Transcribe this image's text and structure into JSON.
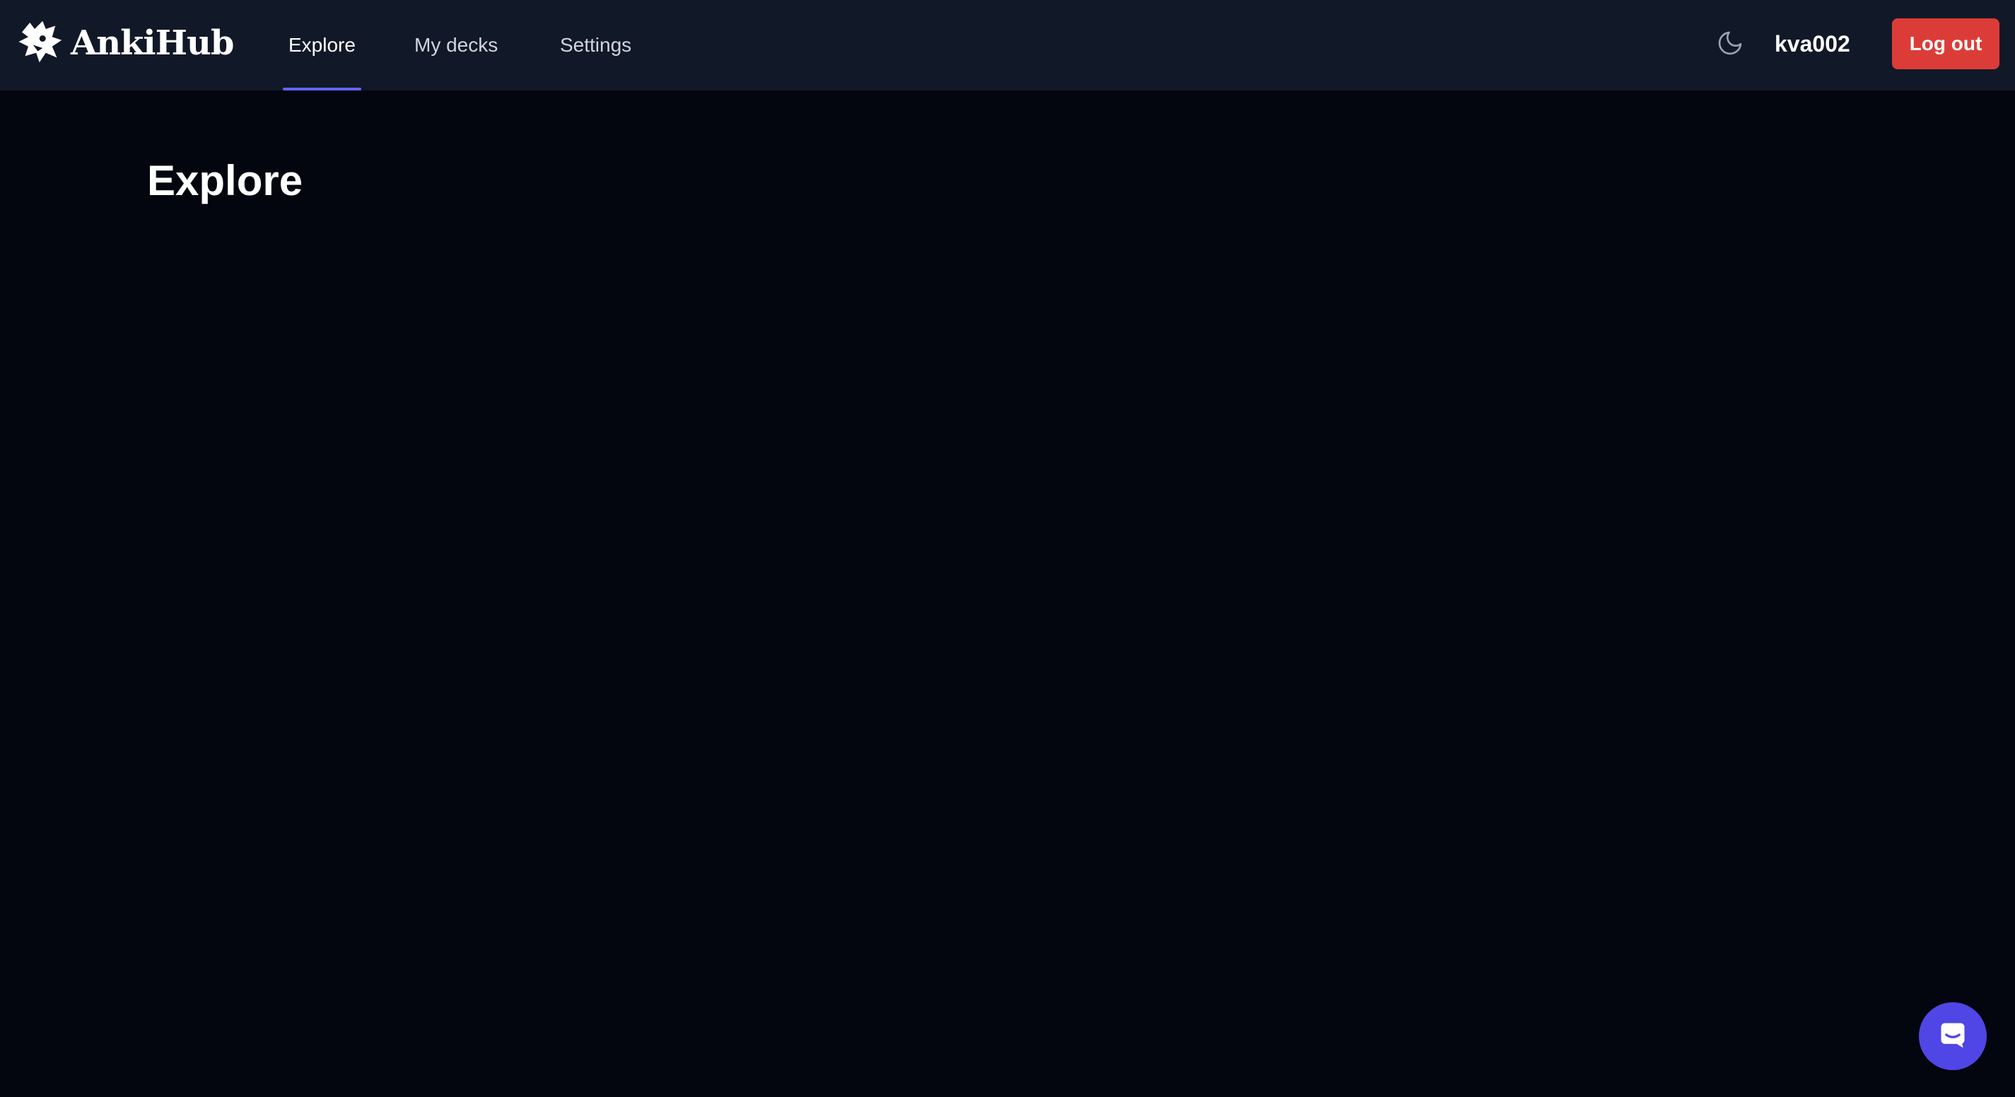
{
  "brand": {
    "name": "AnkiHub",
    "logo_icon": "ankihub-logo-icon"
  },
  "nav": {
    "tabs": [
      {
        "label": "Explore",
        "active": true
      },
      {
        "label": "My decks",
        "active": false
      },
      {
        "label": "Settings",
        "active": false
      }
    ]
  },
  "header": {
    "theme_icon": "moon-icon",
    "username": "kva002",
    "logout_label": "Log out"
  },
  "main": {
    "title": "Explore"
  },
  "chat": {
    "icon": "chat-bubble-icon"
  },
  "colors": {
    "background": "#03050f",
    "navbar": "#111827",
    "accent": "#6366f1",
    "logout": "#dc3c37",
    "chat": "#4f46e5"
  }
}
